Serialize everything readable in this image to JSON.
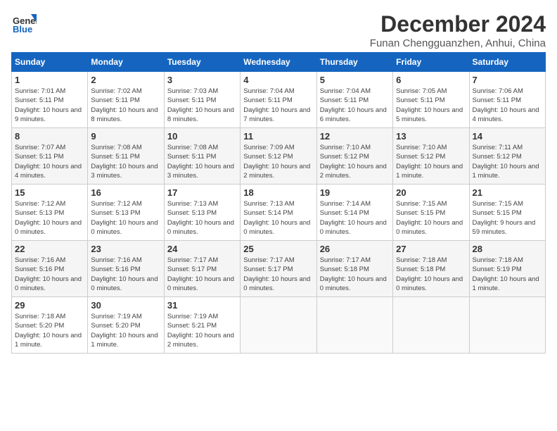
{
  "header": {
    "logo_line1": "General",
    "logo_line2": "Blue",
    "month_title": "December 2024",
    "location": "Funan Chengguanzhen, Anhui, China"
  },
  "weekdays": [
    "Sunday",
    "Monday",
    "Tuesday",
    "Wednesday",
    "Thursday",
    "Friday",
    "Saturday"
  ],
  "weeks": [
    [
      {
        "day": "1",
        "sunrise": "7:01 AM",
        "sunset": "5:11 PM",
        "daylight": "10 hours and 9 minutes."
      },
      {
        "day": "2",
        "sunrise": "7:02 AM",
        "sunset": "5:11 PM",
        "daylight": "10 hours and 8 minutes."
      },
      {
        "day": "3",
        "sunrise": "7:03 AM",
        "sunset": "5:11 PM",
        "daylight": "10 hours and 8 minutes."
      },
      {
        "day": "4",
        "sunrise": "7:04 AM",
        "sunset": "5:11 PM",
        "daylight": "10 hours and 7 minutes."
      },
      {
        "day": "5",
        "sunrise": "7:04 AM",
        "sunset": "5:11 PM",
        "daylight": "10 hours and 6 minutes."
      },
      {
        "day": "6",
        "sunrise": "7:05 AM",
        "sunset": "5:11 PM",
        "daylight": "10 hours and 5 minutes."
      },
      {
        "day": "7",
        "sunrise": "7:06 AM",
        "sunset": "5:11 PM",
        "daylight": "10 hours and 4 minutes."
      }
    ],
    [
      {
        "day": "8",
        "sunrise": "7:07 AM",
        "sunset": "5:11 PM",
        "daylight": "10 hours and 4 minutes."
      },
      {
        "day": "9",
        "sunrise": "7:08 AM",
        "sunset": "5:11 PM",
        "daylight": "10 hours and 3 minutes."
      },
      {
        "day": "10",
        "sunrise": "7:08 AM",
        "sunset": "5:11 PM",
        "daylight": "10 hours and 3 minutes."
      },
      {
        "day": "11",
        "sunrise": "7:09 AM",
        "sunset": "5:12 PM",
        "daylight": "10 hours and 2 minutes."
      },
      {
        "day": "12",
        "sunrise": "7:10 AM",
        "sunset": "5:12 PM",
        "daylight": "10 hours and 2 minutes."
      },
      {
        "day": "13",
        "sunrise": "7:10 AM",
        "sunset": "5:12 PM",
        "daylight": "10 hours and 1 minute."
      },
      {
        "day": "14",
        "sunrise": "7:11 AM",
        "sunset": "5:12 PM",
        "daylight": "10 hours and 1 minute."
      }
    ],
    [
      {
        "day": "15",
        "sunrise": "7:12 AM",
        "sunset": "5:13 PM",
        "daylight": "10 hours and 0 minutes."
      },
      {
        "day": "16",
        "sunrise": "7:12 AM",
        "sunset": "5:13 PM",
        "daylight": "10 hours and 0 minutes."
      },
      {
        "day": "17",
        "sunrise": "7:13 AM",
        "sunset": "5:13 PM",
        "daylight": "10 hours and 0 minutes."
      },
      {
        "day": "18",
        "sunrise": "7:13 AM",
        "sunset": "5:14 PM",
        "daylight": "10 hours and 0 minutes."
      },
      {
        "day": "19",
        "sunrise": "7:14 AM",
        "sunset": "5:14 PM",
        "daylight": "10 hours and 0 minutes."
      },
      {
        "day": "20",
        "sunrise": "7:15 AM",
        "sunset": "5:15 PM",
        "daylight": "10 hours and 0 minutes."
      },
      {
        "day": "21",
        "sunrise": "7:15 AM",
        "sunset": "5:15 PM",
        "daylight": "9 hours and 59 minutes."
      }
    ],
    [
      {
        "day": "22",
        "sunrise": "7:16 AM",
        "sunset": "5:16 PM",
        "daylight": "10 hours and 0 minutes."
      },
      {
        "day": "23",
        "sunrise": "7:16 AM",
        "sunset": "5:16 PM",
        "daylight": "10 hours and 0 minutes."
      },
      {
        "day": "24",
        "sunrise": "7:17 AM",
        "sunset": "5:17 PM",
        "daylight": "10 hours and 0 minutes."
      },
      {
        "day": "25",
        "sunrise": "7:17 AM",
        "sunset": "5:17 PM",
        "daylight": "10 hours and 0 minutes."
      },
      {
        "day": "26",
        "sunrise": "7:17 AM",
        "sunset": "5:18 PM",
        "daylight": "10 hours and 0 minutes."
      },
      {
        "day": "27",
        "sunrise": "7:18 AM",
        "sunset": "5:18 PM",
        "daylight": "10 hours and 0 minutes."
      },
      {
        "day": "28",
        "sunrise": "7:18 AM",
        "sunset": "5:19 PM",
        "daylight": "10 hours and 1 minute."
      }
    ],
    [
      {
        "day": "29",
        "sunrise": "7:18 AM",
        "sunset": "5:20 PM",
        "daylight": "10 hours and 1 minute."
      },
      {
        "day": "30",
        "sunrise": "7:19 AM",
        "sunset": "5:20 PM",
        "daylight": "10 hours and 1 minute."
      },
      {
        "day": "31",
        "sunrise": "7:19 AM",
        "sunset": "5:21 PM",
        "daylight": "10 hours and 2 minutes."
      },
      null,
      null,
      null,
      null
    ]
  ]
}
